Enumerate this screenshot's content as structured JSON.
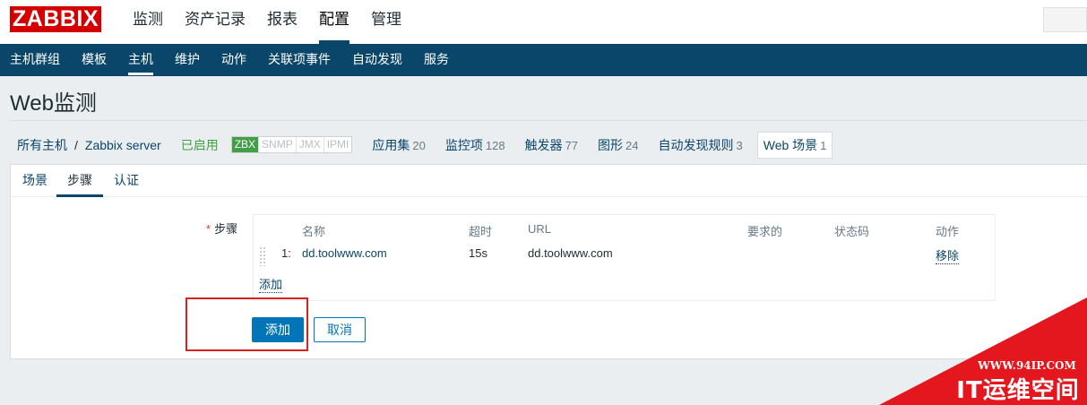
{
  "logo": {
    "text": "ZABBIX"
  },
  "main_menu": [
    {
      "label": "监测",
      "active": false
    },
    {
      "label": "资产记录",
      "active": false
    },
    {
      "label": "报表",
      "active": false
    },
    {
      "label": "配置",
      "active": true
    },
    {
      "label": "管理",
      "active": false
    }
  ],
  "sub_menu": [
    {
      "label": "主机群组",
      "active": false
    },
    {
      "label": "模板",
      "active": false
    },
    {
      "label": "主机",
      "active": true
    },
    {
      "label": "维护",
      "active": false
    },
    {
      "label": "动作",
      "active": false
    },
    {
      "label": "关联项事件",
      "active": false
    },
    {
      "label": "自动发现",
      "active": false
    },
    {
      "label": "服务",
      "active": false
    }
  ],
  "page_title": "Web监测",
  "breadcrumb": {
    "all_hosts": "所有主机",
    "separator": "/",
    "host": "Zabbix server",
    "status": "已启用",
    "interfaces": [
      "ZBX",
      "SNMP",
      "JMX",
      "IPMI"
    ],
    "counts": [
      {
        "label": "应用集",
        "count": "20"
      },
      {
        "label": "监控项",
        "count": "128"
      },
      {
        "label": "触发器",
        "count": "77"
      },
      {
        "label": "图形",
        "count": "24"
      },
      {
        "label": "自动发现规则",
        "count": "3"
      }
    ],
    "web_tab": {
      "label": "Web 场景",
      "count": "1"
    }
  },
  "tabs": [
    {
      "label": "场景",
      "active": false
    },
    {
      "label": "步骤",
      "active": true
    },
    {
      "label": "认证",
      "active": false
    }
  ],
  "form": {
    "steps_label": "步骤",
    "required_mark": "*",
    "columns": {
      "name": "名称",
      "timeout": "超时",
      "url": "URL",
      "required": "要求的",
      "status": "状态码",
      "action": "动作"
    },
    "rows": [
      {
        "index": "1:",
        "name": "dd.toolwww.com",
        "timeout": "15s",
        "url": "dd.toolwww.com",
        "required": "",
        "status": "",
        "action": "移除"
      }
    ],
    "add_link": "添加",
    "submit_button": "添加",
    "cancel_button": "取消"
  },
  "watermark": {
    "url": "WWW.94IP.COM",
    "text": "IT运维空间"
  },
  "colors": {
    "brand_red": "#d40000",
    "nav_blue": "#0a466a",
    "button_blue": "#0275b8",
    "enabled_green": "#429e47",
    "highlight_red": "#d9221c"
  }
}
